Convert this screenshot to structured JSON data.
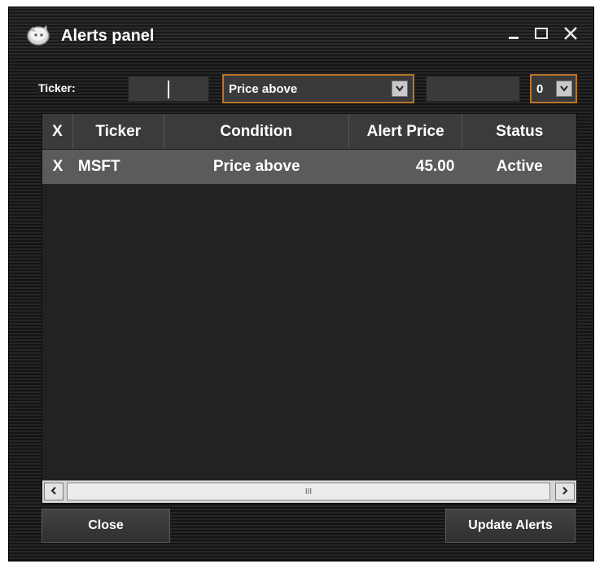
{
  "window": {
    "title": "Alerts panel"
  },
  "toolbar": {
    "ticker_label": "Ticker:",
    "ticker_value": "",
    "condition_value": "Price above",
    "price_value": "",
    "qty_value": "0"
  },
  "table": {
    "columns": [
      "X",
      "Ticker",
      "Condition",
      "Alert Price",
      "Status"
    ],
    "rows": [
      {
        "x": "X",
        "ticker": "MSFT",
        "condition": "Price above",
        "alert_price": "45.00",
        "status": "Active"
      }
    ],
    "scroll_thumb_grip": "III"
  },
  "buttons": {
    "close": "Close",
    "update": "Update Alerts"
  },
  "colors": {
    "accent": "#b8742a",
    "row_selected": "#5b5b5b",
    "header_bg": "#3b3b3b"
  },
  "icons": [
    "app-icon",
    "minimize-icon",
    "maximize-icon",
    "close-icon",
    "chevron-down-icon",
    "chevron-left-icon",
    "chevron-right-icon"
  ]
}
